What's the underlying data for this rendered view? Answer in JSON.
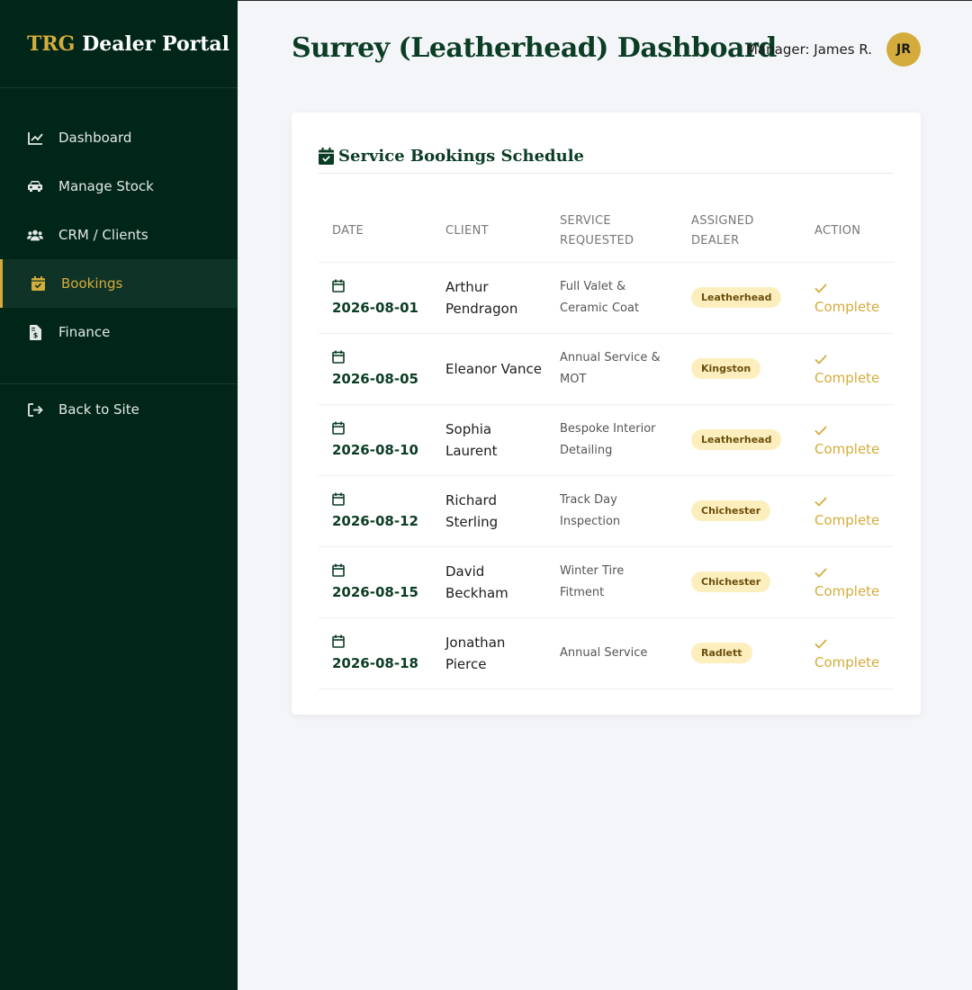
{
  "sidebar": {
    "brand_accent": "TRG",
    "brand_rest": " Dealer Portal",
    "items": [
      {
        "label": "Dashboard",
        "icon": "chart-line-icon"
      },
      {
        "label": "Manage Stock",
        "icon": "car-icon"
      },
      {
        "label": "CRM / Clients",
        "icon": "users-icon"
      },
      {
        "label": "Bookings",
        "icon": "calendar-check-icon",
        "active": true
      },
      {
        "label": "Finance",
        "icon": "invoice-dollar-icon"
      }
    ],
    "back_label": "Back to Site"
  },
  "header": {
    "title": "Surrey (Leatherhead) Dashboard",
    "manager_label": "Manager: James R.",
    "avatar_initials": "JR"
  },
  "card": {
    "title": "Service Bookings Schedule",
    "columns": [
      "DATE",
      "CLIENT",
      "SERVICE REQUESTED",
      "ASSIGNED DEALER",
      "ACTION"
    ],
    "rows": [
      {
        "date": "2026-08-01",
        "client": "Arthur Pendragon",
        "service": "Full Valet & Ceramic Coat",
        "dealer": "Leatherhead",
        "action": "Complete"
      },
      {
        "date": "2026-08-05",
        "client": "Eleanor Vance",
        "service": "Annual Service & MOT",
        "dealer": "Kingston",
        "action": "Complete"
      },
      {
        "date": "2026-08-10",
        "client": "Sophia Laurent",
        "service": "Bespoke Interior Detailing",
        "dealer": "Leatherhead",
        "action": "Complete"
      },
      {
        "date": "2026-08-12",
        "client": "Richard Sterling",
        "service": "Track Day Inspection",
        "dealer": "Chichester",
        "action": "Complete"
      },
      {
        "date": "2026-08-15",
        "client": "David Beckham",
        "service": "Winter Tire Fitment",
        "dealer": "Chichester",
        "action": "Complete"
      },
      {
        "date": "2026-08-18",
        "client": "Jonathan Pierce",
        "service": "Annual Service",
        "dealer": "Radlett",
        "action": "Complete"
      }
    ]
  },
  "colors": {
    "sidebar_bg": "#00261a",
    "accent_gold": "#d4ac3b",
    "title_green": "#0b3d24",
    "badge_bg": "#fdefbd"
  }
}
